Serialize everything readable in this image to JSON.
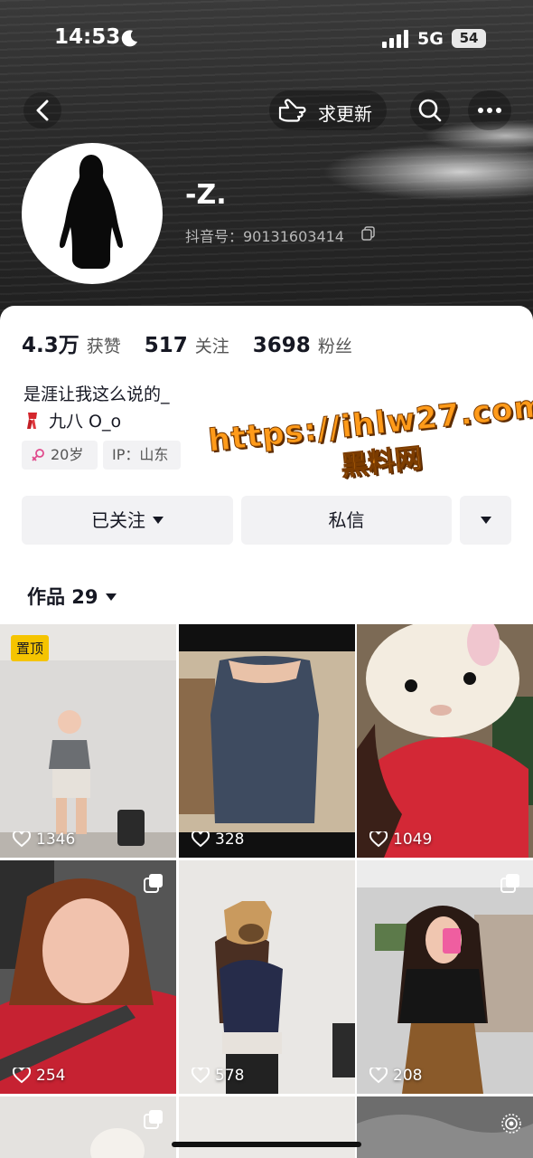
{
  "status_bar": {
    "time": "14:53",
    "network": "5G",
    "battery": "54"
  },
  "nav": {
    "request_update_label": "求更新"
  },
  "profile": {
    "nickname": "-Z.",
    "douyin_id": "抖音号：90131603414"
  },
  "stats": [
    {
      "value": "4.3万",
      "label": "获赞"
    },
    {
      "value": "517",
      "label": "关注"
    },
    {
      "value": "3698",
      "label": "粉丝"
    }
  ],
  "bio": {
    "line1": "是涯让我这么说的_",
    "line2": "九八 O_o"
  },
  "tags": {
    "age": "20岁",
    "ip": "IP：山东"
  },
  "watermark": {
    "url": "https://ihlw27.com",
    "name": "黑料网"
  },
  "actions": {
    "follow_label": "已关注",
    "message_label": "私信"
  },
  "works": {
    "label": "作品 29"
  },
  "grid": {
    "pinned_label": "置顶",
    "items": [
      {
        "likes": "1346"
      },
      {
        "likes": "328"
      },
      {
        "likes": "1049"
      },
      {
        "likes": "254"
      },
      {
        "likes": "578"
      },
      {
        "likes": "208"
      }
    ]
  },
  "colors": {
    "pin_badge": "#f5c400",
    "watermark": "#ff9b1a"
  }
}
